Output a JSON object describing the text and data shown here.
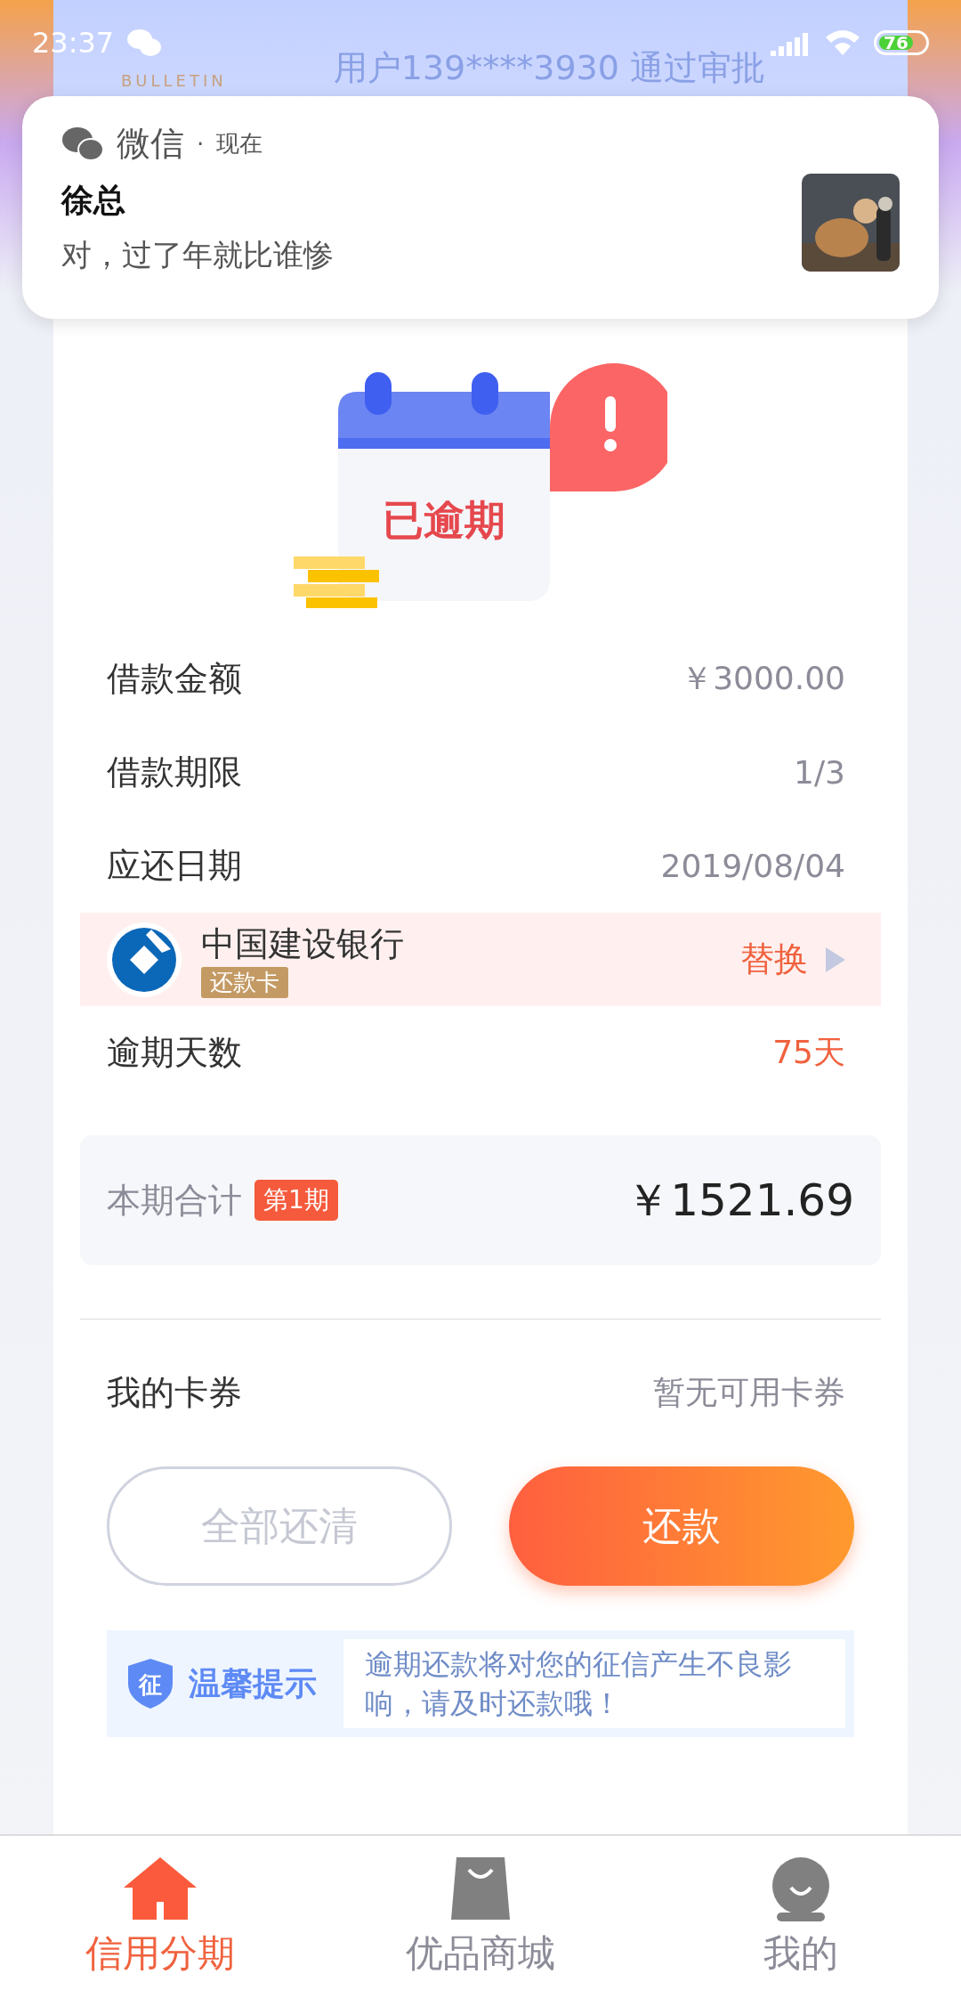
{
  "status_bar": {
    "time": "23:37",
    "battery": "76"
  },
  "bulletin": {
    "logo_sub": "BULLETIN",
    "lines": [
      "用户139****3930 通过审批"
    ]
  },
  "notification": {
    "app": "微信",
    "separator": "·",
    "time": "现在",
    "sender": "徐总",
    "message": "对，过了年就比谁惨"
  },
  "status_illustration": {
    "label": "已逾期"
  },
  "details": [
    {
      "label": "借款金额",
      "value": "￥3000.00",
      "highlight": false
    },
    {
      "label": "借款期限",
      "value": "1/3",
      "highlight": false
    },
    {
      "label": "应还日期",
      "value": "2019/08/04",
      "highlight": false
    }
  ],
  "bank_card": {
    "name": "中国建设银行",
    "tag": "还款卡",
    "action": "替换"
  },
  "overdue": {
    "label": "逾期天数",
    "value": "75天",
    "highlight": true
  },
  "total": {
    "label": "本期合计",
    "badge": "第1期",
    "amount": "￥1521.69"
  },
  "coupon": {
    "label": "我的卡券",
    "value": "暂无可用卡券"
  },
  "buttons": [
    {
      "label": "全部还清",
      "kind": "outline"
    },
    {
      "label": "还款",
      "kind": "primary"
    }
  ],
  "tip": {
    "shield_label": "征",
    "title": "温馨提示",
    "text": "逾期还款将对您的征信产生不良影响，请及时还款哦！"
  },
  "tab_bar": [
    {
      "label": "信用分期",
      "selected": true
    },
    {
      "label": "优品商城",
      "selected": false
    },
    {
      "label": "我的",
      "selected": false
    }
  ]
}
